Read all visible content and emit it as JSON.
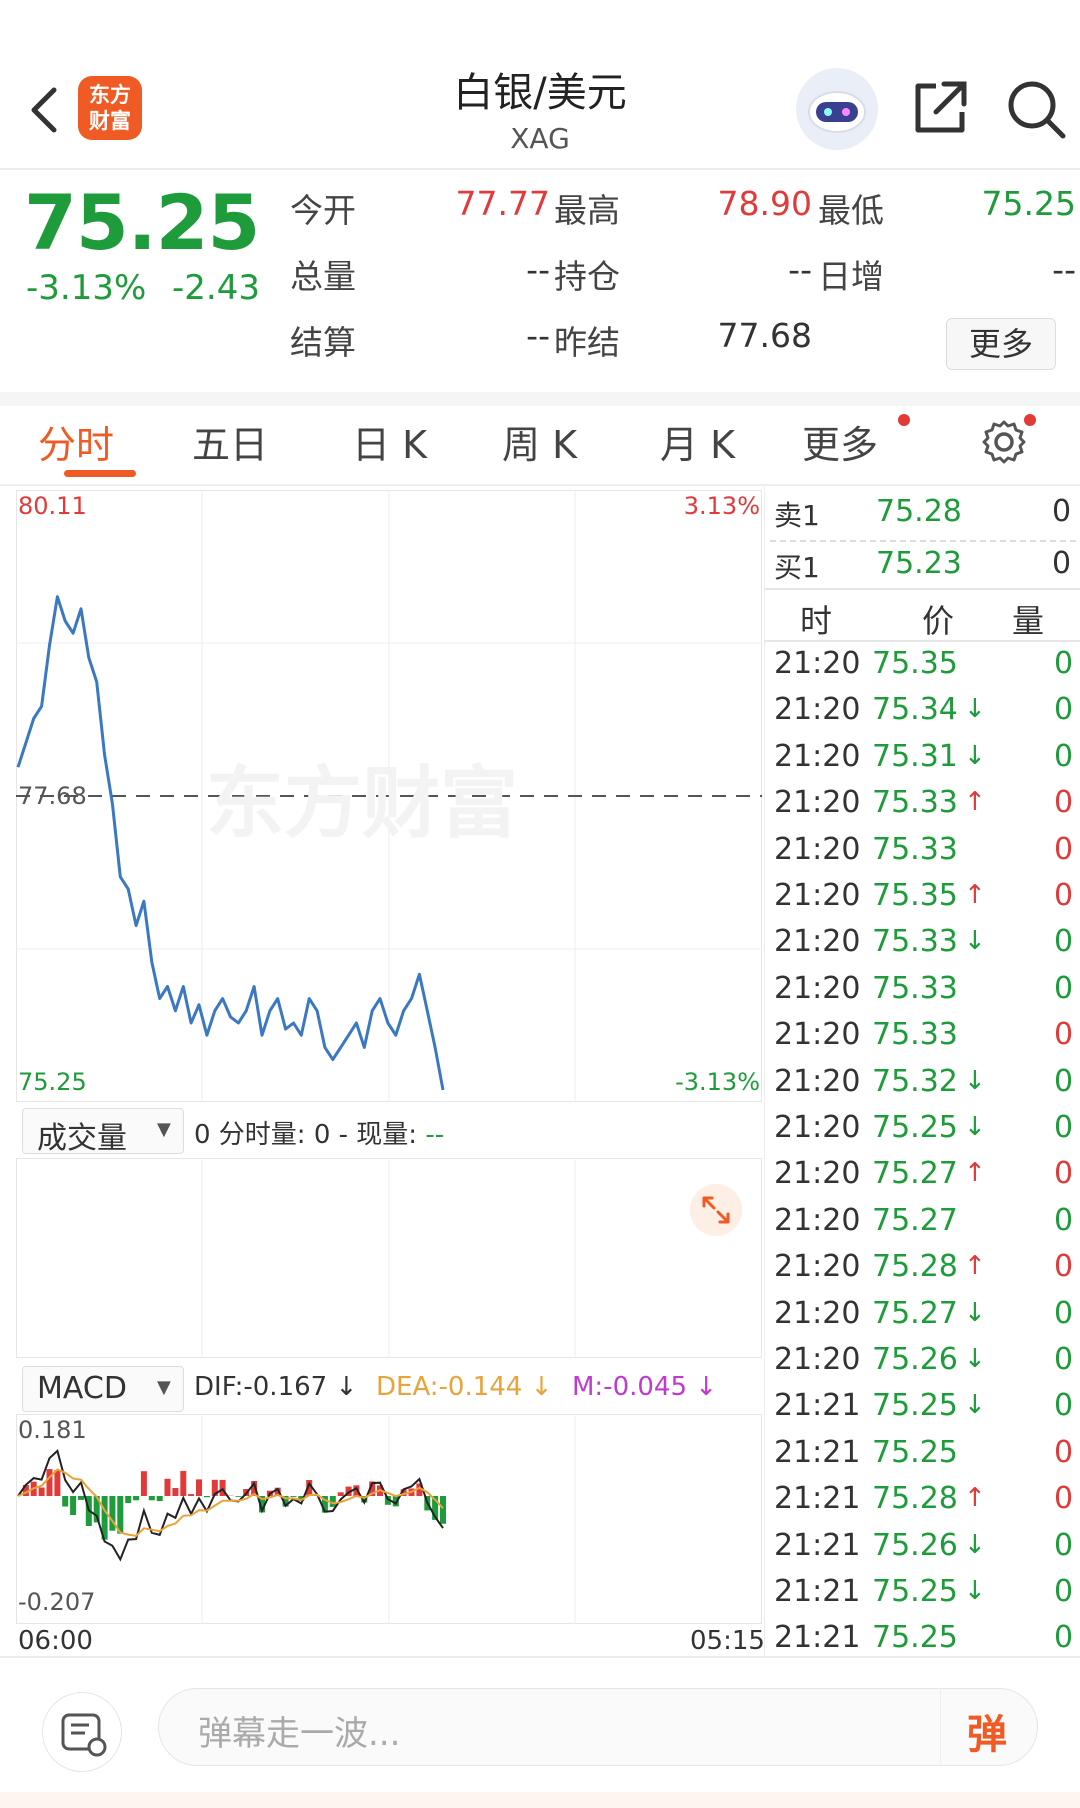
{
  "header": {
    "title": "白银/美元",
    "subtitle": "XAG",
    "logo_text_1": "东方",
    "logo_text_2": "财富"
  },
  "quote": {
    "last_price": "75.25",
    "change_pct": "-3.13%",
    "change": "-2.43",
    "fields": [
      {
        "label": "今开",
        "value": "77.77",
        "color": "#e03a3a"
      },
      {
        "label": "最高",
        "value": "78.90",
        "color": "#e03a3a"
      },
      {
        "label": "最低",
        "value": "75.25",
        "color": "#1e9b3a"
      },
      {
        "label": "总量",
        "value": "--",
        "color": "#333333"
      },
      {
        "label": "持仓",
        "value": "--",
        "color": "#333333"
      },
      {
        "label": "日增",
        "value": "--",
        "color": "#333333"
      },
      {
        "label": "结算",
        "value": "--",
        "color": "#333333"
      },
      {
        "label": "昨结",
        "value": "77.68",
        "color": "#333333"
      }
    ],
    "more_label": "更多"
  },
  "tabs": [
    {
      "label": "分时",
      "active": true
    },
    {
      "label": "五日",
      "active": false
    },
    {
      "label": "日 K",
      "active": false
    },
    {
      "label": "周 K",
      "active": false
    },
    {
      "label": "月 K",
      "active": false
    },
    {
      "label": "更多",
      "active": false
    }
  ],
  "chart_labels": {
    "y_max": "80.11",
    "y_min": "75.25",
    "y_ref": "77.68",
    "pct_max": "3.13%",
    "pct_min": "-3.13%",
    "watermark": "东方财富",
    "volume_selector": "成交量",
    "volume_info_prefix": "0 分时量: 0 - 现量: ",
    "volume_info_value": "--",
    "macd_selector": "MACD",
    "dif": "DIF:-0.167 ↓",
    "dea": "DEA:-0.144 ↓",
    "m": "M:-0.045 ↓",
    "macd_max": "0.181",
    "macd_min": "-0.207",
    "time_start": "06:00",
    "time_end": "05:15"
  },
  "orderbook": {
    "ask_label": "卖1",
    "ask_price": "75.28",
    "ask_qty": "0",
    "bid_label": "买1",
    "bid_price": "75.23",
    "bid_qty": "0",
    "col_time": "时",
    "col_price": "价",
    "col_qty": "量"
  },
  "ticks": [
    {
      "time": "21:20",
      "price": "75.35",
      "arrow": "",
      "qty": "0",
      "qty_color": "#1e9b3a"
    },
    {
      "time": "21:20",
      "price": "75.34",
      "arrow": "↓",
      "qty": "0",
      "qty_color": "#1e9b3a"
    },
    {
      "time": "21:20",
      "price": "75.31",
      "arrow": "↓",
      "qty": "0",
      "qty_color": "#1e9b3a"
    },
    {
      "time": "21:20",
      "price": "75.33",
      "arrow": "↑",
      "qty": "0",
      "qty_color": "#e03a3a"
    },
    {
      "time": "21:20",
      "price": "75.33",
      "arrow": "",
      "qty": "0",
      "qty_color": "#e03a3a"
    },
    {
      "time": "21:20",
      "price": "75.35",
      "arrow": "↑",
      "qty": "0",
      "qty_color": "#e03a3a"
    },
    {
      "time": "21:20",
      "price": "75.33",
      "arrow": "↓",
      "qty": "0",
      "qty_color": "#1e9b3a"
    },
    {
      "time": "21:20",
      "price": "75.33",
      "arrow": "",
      "qty": "0",
      "qty_color": "#1e9b3a"
    },
    {
      "time": "21:20",
      "price": "75.33",
      "arrow": "",
      "qty": "0",
      "qty_color": "#e03a3a"
    },
    {
      "time": "21:20",
      "price": "75.32",
      "arrow": "↓",
      "qty": "0",
      "qty_color": "#1e9b3a"
    },
    {
      "time": "21:20",
      "price": "75.25",
      "arrow": "↓",
      "qty": "0",
      "qty_color": "#1e9b3a"
    },
    {
      "time": "21:20",
      "price": "75.27",
      "arrow": "↑",
      "qty": "0",
      "qty_color": "#e03a3a"
    },
    {
      "time": "21:20",
      "price": "75.27",
      "arrow": "",
      "qty": "0",
      "qty_color": "#1e9b3a"
    },
    {
      "time": "21:20",
      "price": "75.28",
      "arrow": "↑",
      "qty": "0",
      "qty_color": "#e03a3a"
    },
    {
      "time": "21:20",
      "price": "75.27",
      "arrow": "↓",
      "qty": "0",
      "qty_color": "#1e9b3a"
    },
    {
      "time": "21:20",
      "price": "75.26",
      "arrow": "↓",
      "qty": "0",
      "qty_color": "#1e9b3a"
    },
    {
      "time": "21:21",
      "price": "75.25",
      "arrow": "↓",
      "qty": "0",
      "qty_color": "#1e9b3a"
    },
    {
      "time": "21:21",
      "price": "75.25",
      "arrow": "",
      "qty": "0",
      "qty_color": "#e03a3a"
    },
    {
      "time": "21:21",
      "price": "75.28",
      "arrow": "↑",
      "qty": "0",
      "qty_color": "#e03a3a"
    },
    {
      "time": "21:21",
      "price": "75.26",
      "arrow": "↓",
      "qty": "0",
      "qty_color": "#1e9b3a"
    },
    {
      "time": "21:21",
      "price": "75.25",
      "arrow": "↓",
      "qty": "0",
      "qty_color": "#1e9b3a"
    },
    {
      "time": "21:21",
      "price": "75.25",
      "arrow": "",
      "qty": "0",
      "qty_color": "#1e9b3a"
    }
  ],
  "bottom_bar": {
    "placeholder": "弹幕走一波...",
    "button_label": "弹"
  },
  "colors": {
    "accent": "#f05a24",
    "up": "#e03a3a",
    "down": "#1e9b3a",
    "price_line": "#3a78c2",
    "dea_color": "#e8a33a",
    "m_color": "#c03ad0"
  },
  "chart_data": {
    "type": "line",
    "x_range": [
      "06:00",
      "05:15"
    ],
    "ylim": [
      75.25,
      80.11
    ],
    "reference": 77.68,
    "series": [
      {
        "values": [
          77.9,
          78.1,
          78.3,
          78.4,
          78.9,
          79.3,
          79.1,
          79.0,
          79.2,
          78.8,
          78.6,
          78.0,
          77.6,
          77.0,
          76.9,
          76.6,
          76.8,
          76.3,
          76.0,
          76.1,
          75.9,
          76.1,
          75.8,
          75.95,
          75.7,
          75.9,
          76.0,
          75.85,
          75.8,
          75.9,
          76.1,
          75.7,
          75.9,
          76.0,
          75.75,
          75.8,
          75.7,
          76.0,
          75.9,
          75.6,
          75.5,
          75.6,
          75.7,
          75.8,
          75.6,
          75.9,
          76.0,
          75.8,
          75.7,
          75.9,
          76.0,
          76.2,
          75.9,
          75.6,
          75.25
        ]
      }
    ]
  }
}
